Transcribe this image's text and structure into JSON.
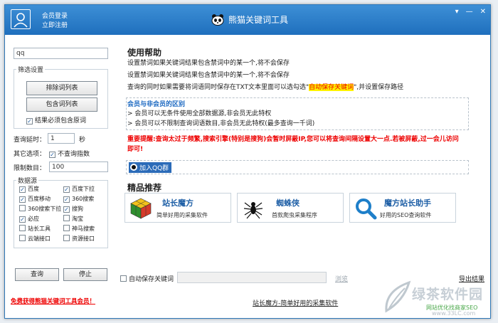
{
  "titlebar": {
    "login_label": "会员登录",
    "register_label": "立即注册",
    "app_title": "熊猫关键词工具",
    "controls": [
      "▾",
      "—",
      "✕"
    ]
  },
  "left": {
    "keyword_input": "qq",
    "filter_group_title": "筛选设置",
    "exclude_list_button": "排除词列表",
    "include_list_button": "包含词列表",
    "must_include_label": "结果必须包含原词",
    "must_include_checked": true,
    "timeout_label": "查询延时：",
    "timeout_value": "1",
    "timeout_unit": "秒",
    "other_options_label": "其它选项：",
    "no_query_index_label": "不查询指数",
    "no_query_index_checked": true,
    "limit_label": "限制数目：",
    "limit_value": "100",
    "datasource_title": "数据源",
    "sources": [
      {
        "label": "百度",
        "checked": true
      },
      {
        "label": "百度下拉",
        "checked": true
      },
      {
        "label": "百度移动",
        "checked": true
      },
      {
        "label": "360搜索",
        "checked": true
      },
      {
        "label": "360搜索下拉",
        "checked": false
      },
      {
        "label": "搜狗",
        "checked": true
      },
      {
        "label": "必应",
        "checked": true
      },
      {
        "label": "淘宝",
        "checked": false
      },
      {
        "label": "站长工具",
        "checked": false
      },
      {
        "label": "神马搜索",
        "checked": false
      },
      {
        "label": "云端接口",
        "checked": false
      },
      {
        "label": "资源接口",
        "checked": false
      }
    ],
    "query_button": "查询",
    "stop_button": "停止",
    "free_member_link": "免费获得熊猫关键词工具会员！"
  },
  "help": {
    "title": "使用帮助",
    "line1": "设置禁词如果关键词结果包含禁词中的某一个,将不会保存",
    "line2": "设置禁词如果关键词结果包含禁词中的某一个,将不会保存",
    "line3_a": "查询的同时如果需要将词语同时保存在TXT文本里面可以选勾选\"",
    "line3_hl": "自动保存关键词",
    "line3_b": "\",并设置保存路径",
    "member_title": "会员与非会员的区别",
    "member_line1": "> 会员可以无条件使用全部数据源,非会员无此特权",
    "member_line2": "> 会员可以不限制查询词语数目,非会员无此特权(最多查询一千词)",
    "warning": "重要提醒:查询太过于频繁,搜索引擎(特别是搜狗)会暂时屏蔽IP,您可以将查询间隔设置大一点.若被屏蔽,过一会儿访问即可!",
    "qq_group_button": "加入QQ群"
  },
  "recommend": {
    "title": "精品推荐",
    "cards": [
      {
        "title": "站长魔方",
        "subtitle": "简单好用的采集软件"
      },
      {
        "title": "蜘蛛侠",
        "subtitle": "首款爬虫采集程序"
      },
      {
        "title": "魔方站长助手",
        "subtitle": "好用的SEO查询软件"
      }
    ]
  },
  "bottom": {
    "auto_save_label": "自动保存关键词",
    "auto_save_checked": false,
    "path_value": "",
    "browse_link": "浏览",
    "export_link": "导出结果",
    "footer_link": "站长魔方-简单好用的采集软件",
    "watermark_text": "绿茶软件园",
    "watermark_sub": "网站优化找商家SEO",
    "watermark_url": "www.33LC.com"
  },
  "colors": {
    "titlebar": "#2a7fc9",
    "accent_blue": "#1e6ac2",
    "warning_red": "#e00000",
    "highlight": "#fff200"
  }
}
